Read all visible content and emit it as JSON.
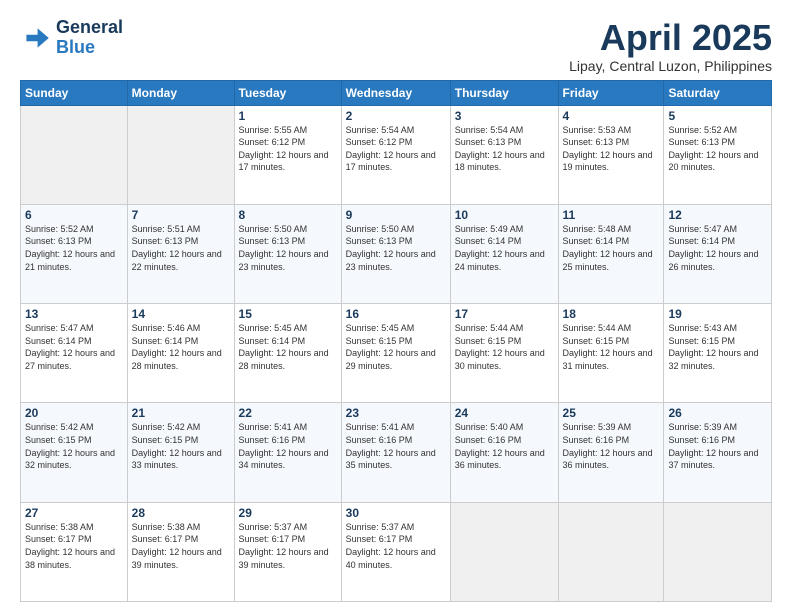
{
  "header": {
    "logo_line1": "General",
    "logo_line2": "Blue",
    "month": "April 2025",
    "location": "Lipay, Central Luzon, Philippines"
  },
  "weekdays": [
    "Sunday",
    "Monday",
    "Tuesday",
    "Wednesday",
    "Thursday",
    "Friday",
    "Saturday"
  ],
  "weeks": [
    [
      {
        "day": "",
        "info": ""
      },
      {
        "day": "",
        "info": ""
      },
      {
        "day": "1",
        "info": "Sunrise: 5:55 AM\nSunset: 6:12 PM\nDaylight: 12 hours\nand 17 minutes."
      },
      {
        "day": "2",
        "info": "Sunrise: 5:54 AM\nSunset: 6:12 PM\nDaylight: 12 hours\nand 17 minutes."
      },
      {
        "day": "3",
        "info": "Sunrise: 5:54 AM\nSunset: 6:13 PM\nDaylight: 12 hours\nand 18 minutes."
      },
      {
        "day": "4",
        "info": "Sunrise: 5:53 AM\nSunset: 6:13 PM\nDaylight: 12 hours\nand 19 minutes."
      },
      {
        "day": "5",
        "info": "Sunrise: 5:52 AM\nSunset: 6:13 PM\nDaylight: 12 hours\nand 20 minutes."
      }
    ],
    [
      {
        "day": "6",
        "info": "Sunrise: 5:52 AM\nSunset: 6:13 PM\nDaylight: 12 hours\nand 21 minutes."
      },
      {
        "day": "7",
        "info": "Sunrise: 5:51 AM\nSunset: 6:13 PM\nDaylight: 12 hours\nand 22 minutes."
      },
      {
        "day": "8",
        "info": "Sunrise: 5:50 AM\nSunset: 6:13 PM\nDaylight: 12 hours\nand 23 minutes."
      },
      {
        "day": "9",
        "info": "Sunrise: 5:50 AM\nSunset: 6:13 PM\nDaylight: 12 hours\nand 23 minutes."
      },
      {
        "day": "10",
        "info": "Sunrise: 5:49 AM\nSunset: 6:14 PM\nDaylight: 12 hours\nand 24 minutes."
      },
      {
        "day": "11",
        "info": "Sunrise: 5:48 AM\nSunset: 6:14 PM\nDaylight: 12 hours\nand 25 minutes."
      },
      {
        "day": "12",
        "info": "Sunrise: 5:47 AM\nSunset: 6:14 PM\nDaylight: 12 hours\nand 26 minutes."
      }
    ],
    [
      {
        "day": "13",
        "info": "Sunrise: 5:47 AM\nSunset: 6:14 PM\nDaylight: 12 hours\nand 27 minutes."
      },
      {
        "day": "14",
        "info": "Sunrise: 5:46 AM\nSunset: 6:14 PM\nDaylight: 12 hours\nand 28 minutes."
      },
      {
        "day": "15",
        "info": "Sunrise: 5:45 AM\nSunset: 6:14 PM\nDaylight: 12 hours\nand 28 minutes."
      },
      {
        "day": "16",
        "info": "Sunrise: 5:45 AM\nSunset: 6:15 PM\nDaylight: 12 hours\nand 29 minutes."
      },
      {
        "day": "17",
        "info": "Sunrise: 5:44 AM\nSunset: 6:15 PM\nDaylight: 12 hours\nand 30 minutes."
      },
      {
        "day": "18",
        "info": "Sunrise: 5:44 AM\nSunset: 6:15 PM\nDaylight: 12 hours\nand 31 minutes."
      },
      {
        "day": "19",
        "info": "Sunrise: 5:43 AM\nSunset: 6:15 PM\nDaylight: 12 hours\nand 32 minutes."
      }
    ],
    [
      {
        "day": "20",
        "info": "Sunrise: 5:42 AM\nSunset: 6:15 PM\nDaylight: 12 hours\nand 32 minutes."
      },
      {
        "day": "21",
        "info": "Sunrise: 5:42 AM\nSunset: 6:15 PM\nDaylight: 12 hours\nand 33 minutes."
      },
      {
        "day": "22",
        "info": "Sunrise: 5:41 AM\nSunset: 6:16 PM\nDaylight: 12 hours\nand 34 minutes."
      },
      {
        "day": "23",
        "info": "Sunrise: 5:41 AM\nSunset: 6:16 PM\nDaylight: 12 hours\nand 35 minutes."
      },
      {
        "day": "24",
        "info": "Sunrise: 5:40 AM\nSunset: 6:16 PM\nDaylight: 12 hours\nand 36 minutes."
      },
      {
        "day": "25",
        "info": "Sunrise: 5:39 AM\nSunset: 6:16 PM\nDaylight: 12 hours\nand 36 minutes."
      },
      {
        "day": "26",
        "info": "Sunrise: 5:39 AM\nSunset: 6:16 PM\nDaylight: 12 hours\nand 37 minutes."
      }
    ],
    [
      {
        "day": "27",
        "info": "Sunrise: 5:38 AM\nSunset: 6:17 PM\nDaylight: 12 hours\nand 38 minutes."
      },
      {
        "day": "28",
        "info": "Sunrise: 5:38 AM\nSunset: 6:17 PM\nDaylight: 12 hours\nand 39 minutes."
      },
      {
        "day": "29",
        "info": "Sunrise: 5:37 AM\nSunset: 6:17 PM\nDaylight: 12 hours\nand 39 minutes."
      },
      {
        "day": "30",
        "info": "Sunrise: 5:37 AM\nSunset: 6:17 PM\nDaylight: 12 hours\nand 40 minutes."
      },
      {
        "day": "",
        "info": ""
      },
      {
        "day": "",
        "info": ""
      },
      {
        "day": "",
        "info": ""
      }
    ]
  ]
}
